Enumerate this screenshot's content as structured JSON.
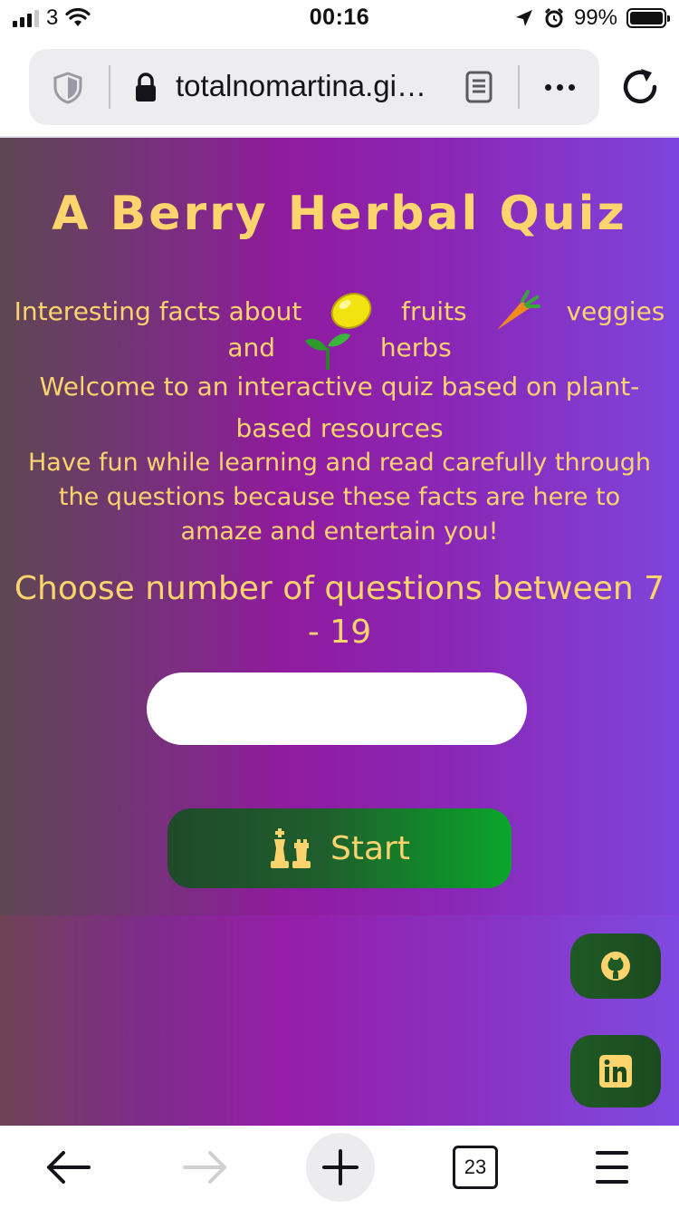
{
  "status_bar": {
    "carrier": "3",
    "time": "00:16",
    "battery_percent": "99%",
    "battery_level": 0.99
  },
  "browser": {
    "url_display": "totalnomartina.gi…",
    "tab_count": "23"
  },
  "quiz": {
    "title": "A Berry Herbal Quiz",
    "facts_prefix": "Interesting facts about",
    "facts_fruits": "fruits",
    "facts_veggies": "veggies",
    "facts_and": "and",
    "facts_herbs": "herbs",
    "welcome_text": "Welcome to an interactive quiz based on plant-based resources",
    "have_fun_text": "Have fun while learning and read carefully through the questions because these facts are here to amaze and entertain you!",
    "choose_text": "Choose number of questions between 7 - 19",
    "number_input_value": "",
    "start_label": "Start"
  },
  "colors": {
    "accent_text": "#fbd46d",
    "button_green": "#1f5e2c"
  },
  "icons": {
    "shield": "shield-icon",
    "lock": "lock-icon",
    "reader": "reader-mode-icon",
    "more": "more-icon",
    "reload": "reload-icon",
    "lemon": "lemon-icon",
    "carrot": "carrot-icon",
    "seedling": "seedling-icon",
    "chess": "chess-icon",
    "github": "github-icon",
    "linkedin": "linkedin-icon",
    "back": "back-arrow-icon",
    "forward": "forward-arrow-icon",
    "new_tab": "plus-icon",
    "menu": "menu-icon"
  }
}
